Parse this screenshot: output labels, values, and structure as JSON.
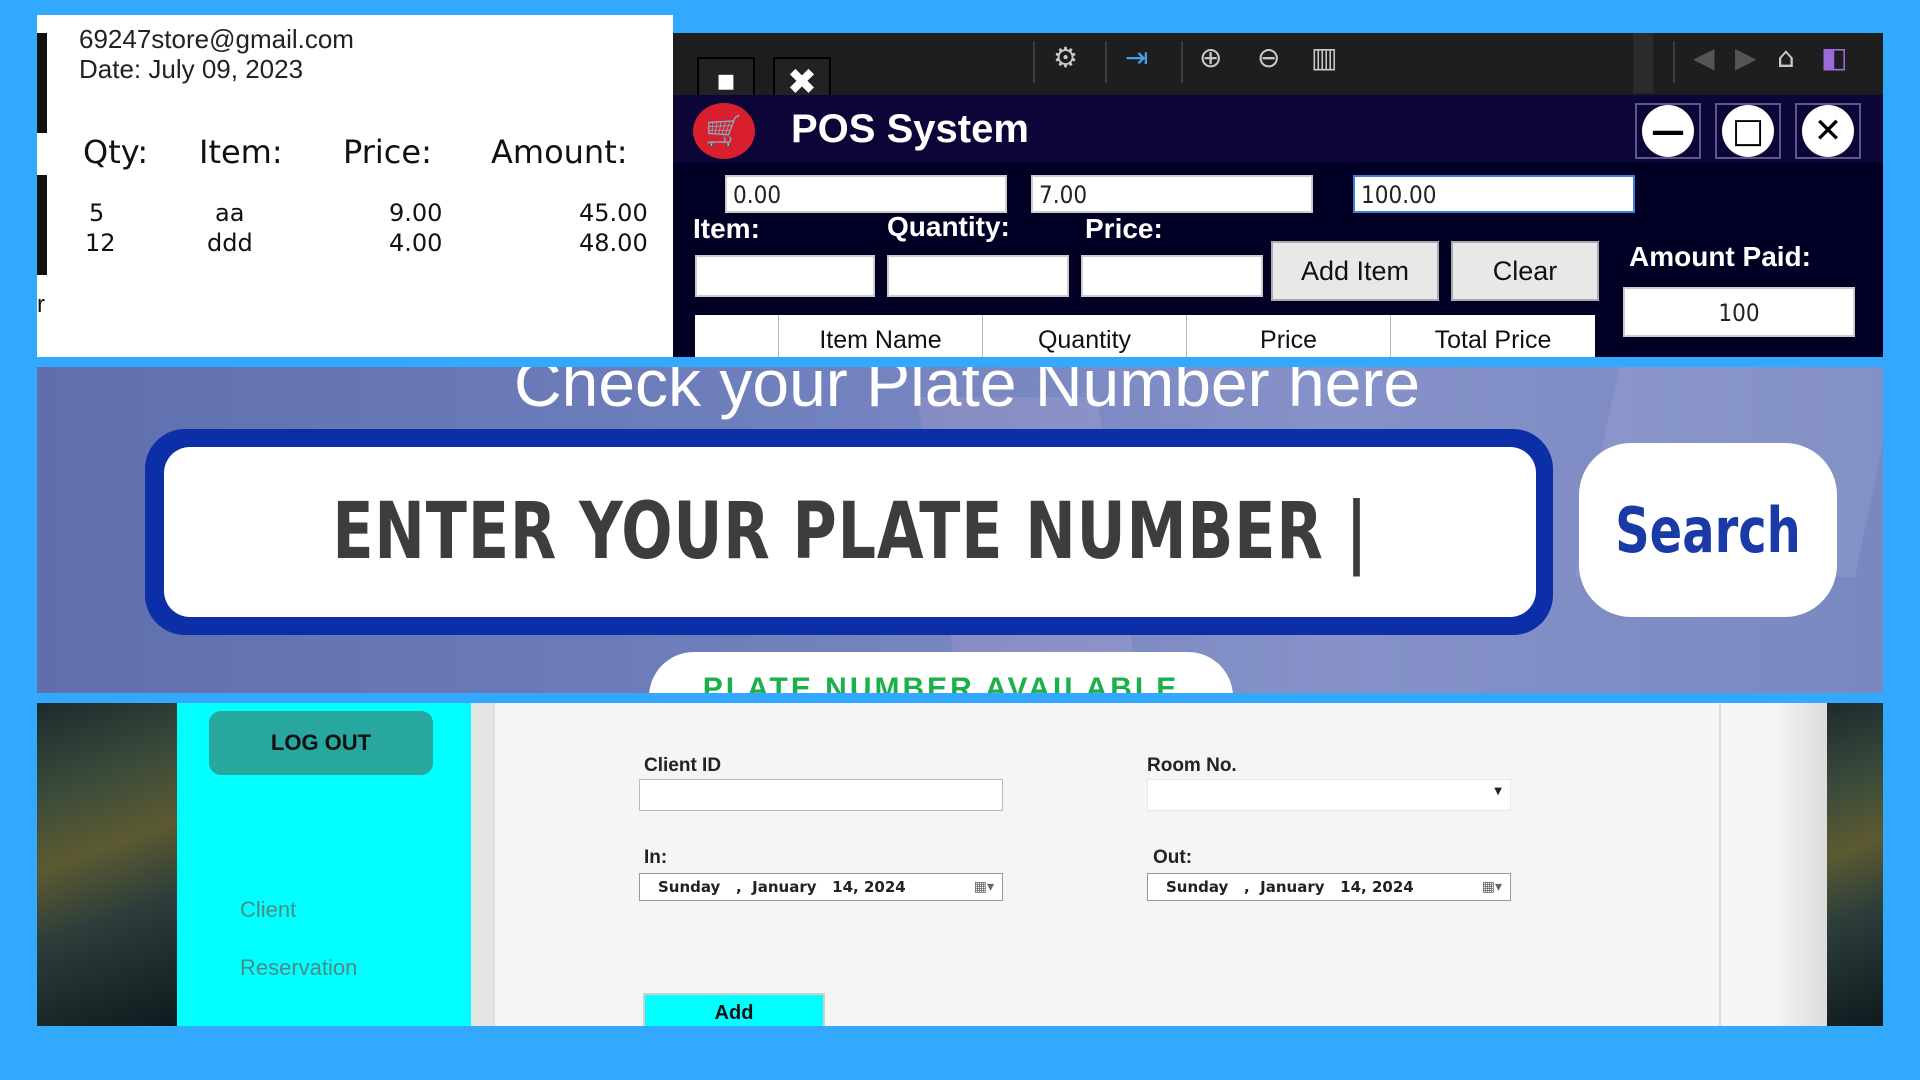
{
  "receipt": {
    "email": "69247store@gmail.com",
    "date": "Date: July 09, 2023",
    "headers": {
      "qty": "Qty:",
      "item": "Item:",
      "price": "Price:",
      "amount": "Amount:"
    },
    "rows": [
      {
        "qty": "5",
        "item": "aa",
        "price": "9.00",
        "amount": "45.00"
      },
      {
        "qty": "12",
        "item": "ddd",
        "price": "4.00",
        "amount": "48.00"
      }
    ],
    "edge_char": "r"
  },
  "pos": {
    "title": "POS System",
    "toolbar_icons": [
      "gear-icon",
      "export-icon",
      "zoom-in-icon",
      "zoom-out-icon",
      "chart-icon",
      "back-icon",
      "forward-icon",
      "home-icon",
      "visual-studio-icon"
    ],
    "totals": {
      "field1": "0.00",
      "field2": "7.00",
      "field3": "100.00"
    },
    "labels": {
      "item": "Item:",
      "quantity": "Quantity:",
      "price": "Price:",
      "amount_paid": "Amount Paid:"
    },
    "buttons": {
      "add_item": "Add Item",
      "clear": "Clear"
    },
    "amount_paid_value": "100",
    "grid_headers": [
      "",
      "Item Name",
      "Quantity",
      "Price",
      "Total Price"
    ],
    "window_buttons": {
      "minimize": "—",
      "maximize": "□",
      "close": "✕"
    }
  },
  "plate": {
    "heading": "Check your Plate Number here",
    "placeholder": "ENTER YOUR PLATE NUMBER |",
    "search_label": "Search",
    "status": "PLATE NUMBER AVAILABLE"
  },
  "reservation": {
    "logout": "LOG OUT",
    "sidebar_items": [
      "Client",
      "Reservation"
    ],
    "labels": {
      "client_id": "Client ID",
      "room_no": "Room No.",
      "in": "In:",
      "out": "Out:"
    },
    "in_date": "Sunday   ,  January   14, 2024",
    "out_date": "Sunday   ,  January   14, 2024",
    "add_label": "Add"
  },
  "colors": {
    "frame": "#33a8ff",
    "pos_titlebar": "#0c0538",
    "plate_border": "#0c2fa8",
    "search_text": "#1a3aa8",
    "available_green": "#1bb04a",
    "sidebar": "#00ffff",
    "logout_button": "#27a79e"
  }
}
